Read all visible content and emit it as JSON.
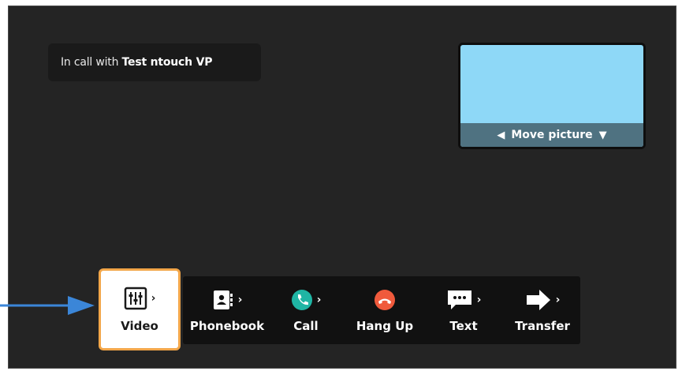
{
  "call": {
    "prefix": "In call with",
    "contact": "Test ntouch VP"
  },
  "self_view": {
    "move_label": "Move picture",
    "left_arrow": "🡐",
    "right_arrow": "🡓",
    "background_color": "#8ed8f7"
  },
  "toolbar": {
    "buttons": [
      {
        "label": "Video",
        "icon": "video-settings-icon",
        "selected": true
      },
      {
        "label": "Phonebook",
        "icon": "phonebook-icon"
      },
      {
        "label": "Call",
        "icon": "phone-icon",
        "color": "#1fb5a4"
      },
      {
        "label": "Hang Up",
        "icon": "hang-up-icon",
        "color": "#f05a3c"
      },
      {
        "label": "Text",
        "icon": "chat-icon"
      },
      {
        "label": "Transfer",
        "icon": "transfer-icon"
      }
    ],
    "chevron": "›",
    "selected_border_color": "#f2a649"
  },
  "callout_arrow_color": "#3b86d8"
}
